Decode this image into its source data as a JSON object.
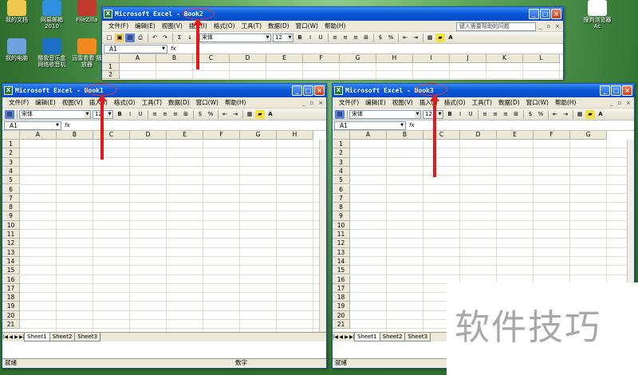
{
  "desktop": {
    "icons": [
      {
        "label": "我的文档",
        "icon": "folder-icon",
        "color": "#f0c850"
      },
      {
        "label": "我的电脑",
        "icon": "computer-icon",
        "color": "#6fa0e0"
      },
      {
        "label": "网易邮箱 2010",
        "icon": "mail-icon",
        "color": "#2f8fe0"
      },
      {
        "label": "酷我音乐盒 网络收音机",
        "icon": "wifi-icon",
        "color": "#1b6fc4"
      },
      {
        "label": "FileZilla",
        "icon": "filezilla-icon",
        "color": "#c0392b"
      },
      {
        "label": "迅雷看看 播放器",
        "icon": "player-icon",
        "color": "#f08a1f"
      },
      {
        "label": "搜狗浏览器 Ac",
        "icon": "document-icon",
        "color": "#ffffff"
      }
    ]
  },
  "book2": {
    "app": "Microsoft Excel",
    "sep": " - ",
    "book": "Book2",
    "menu": [
      "文件(F)",
      "编辑(E)",
      "视图(V)",
      "插入(I)",
      "格式(O)",
      "工具(T)",
      "数据(D)",
      "窗口(W)",
      "帮助(H)"
    ],
    "help_placeholder": "键入需要帮助的问题",
    "font": "宋体",
    "size": "12",
    "cell": "A1",
    "fx": "fx",
    "columns": [
      "A",
      "B",
      "C",
      "D",
      "E",
      "F",
      "G",
      "H",
      "I",
      "J",
      "K",
      "L"
    ],
    "rows": [
      "1",
      "2"
    ]
  },
  "book1": {
    "app": "Microsoft Excel",
    "sep": " - ",
    "book": "Book1",
    "menu": [
      "文件(F)",
      "编辑(E)",
      "视图(V)",
      "插入(I)",
      "格式(O)",
      "工具(T)",
      "数据(D)",
      "窗口(W)",
      "帮助(H)"
    ],
    "font": "宋体",
    "size": "12",
    "cell": "A1",
    "fx": "fx",
    "columns": [
      "A",
      "B",
      "C",
      "D",
      "E",
      "F",
      "G",
      "H"
    ],
    "rows": [
      "1",
      "2",
      "3",
      "4",
      "5",
      "6",
      "7",
      "8",
      "9",
      "10",
      "11",
      "12",
      "13",
      "14",
      "15",
      "16",
      "17",
      "18",
      "19",
      "20",
      "21",
      "22",
      "23"
    ],
    "sheets": [
      "Sheet1",
      "Sheet2",
      "Sheet3"
    ],
    "status": "就绪",
    "status_right": "数字"
  },
  "book3": {
    "app": "Microsoft Excel",
    "sep": " - ",
    "book": "Book3",
    "menu": [
      "文件(F)",
      "编辑(E)",
      "视图(V)",
      "插入(I)",
      "格式(O)",
      "工具(T)",
      "数据(D)",
      "窗口(W)",
      "帮助(H)"
    ],
    "font": "宋体",
    "size": "12",
    "cell": "A1",
    "fx": "fx",
    "columns": [
      "A",
      "B",
      "C",
      "D",
      "E",
      "F",
      "G"
    ],
    "rows": [
      "1",
      "2",
      "3",
      "4",
      "5",
      "6",
      "7",
      "8",
      "9",
      "10",
      "11",
      "12",
      "13",
      "14",
      "15",
      "16",
      "17",
      "18",
      "19",
      "20",
      "21",
      "22",
      "23"
    ],
    "sheets": [
      "Sheet1",
      "Sheet2",
      "Sheet3"
    ],
    "status": "就绪"
  },
  "watermark": "软件技巧",
  "colors": {
    "annotation": "#e11b1b",
    "titlebar": "#0a5ad8",
    "chrome": "#ece9d8"
  }
}
